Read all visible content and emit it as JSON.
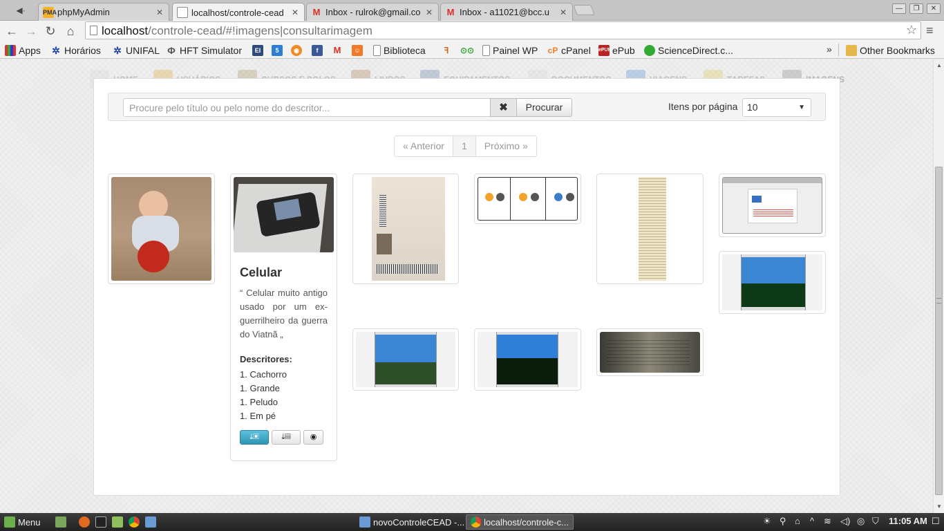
{
  "tabs": [
    {
      "title": "phpMyAdmin",
      "favicon": "pma-icon",
      "active": false
    },
    {
      "title": "localhost/controle-cead",
      "favicon": "page-icon",
      "active": true
    },
    {
      "title": "Inbox - rulrok@gmail.co",
      "favicon": "gmail-icon",
      "active": false
    },
    {
      "title": "Inbox - a11021@bcc.u",
      "favicon": "gmail-icon",
      "active": false
    }
  ],
  "address_bar": {
    "host": "localhost",
    "path": "/controle-cead/#!imagens|consultarimagem"
  },
  "bookmarks": [
    {
      "label": "Apps",
      "icon": "apps-grid-icon"
    },
    {
      "label": "Horários",
      "icon": "unifal-icon"
    },
    {
      "label": "UNIFAL",
      "icon": "unifal-icon"
    },
    {
      "label": "HFT Simulator",
      "icon": "hft-icon"
    },
    {
      "label": "",
      "icon": "blue-square-icon"
    },
    {
      "label": "",
      "icon": "five-icon"
    },
    {
      "label": "",
      "icon": "orange-circle-icon"
    },
    {
      "label": "",
      "icon": "facebook-icon"
    },
    {
      "label": "",
      "icon": "gmail-icon"
    },
    {
      "label": "",
      "icon": "orange-square-icon"
    },
    {
      "label": "Biblioteca",
      "icon": "page-icon"
    },
    {
      "label": "",
      "icon": "feather-icon"
    },
    {
      "label": "",
      "icon": "owl-icon"
    },
    {
      "label": "Painel WP",
      "icon": "page-icon"
    },
    {
      "label": "cPanel",
      "icon": "cpanel-icon"
    },
    {
      "label": "ePub",
      "icon": "epub-icon"
    },
    {
      "label": "ScienceDirect.c...",
      "icon": "green-circle-icon"
    }
  ],
  "bookmarks_more": "»",
  "other_bookmarks": "Other Bookmarks",
  "bg_nav": [
    "HOME",
    "USUÁRIOS",
    "CURSOS E POLOS",
    "LIVROS",
    "EQUIPAMENTOS",
    "DOCUMENTOS",
    "VIAGENS",
    "TAREFAS",
    "IMAGENS"
  ],
  "search": {
    "placeholder": "Procure pelo título ou pelo nome do descritor...",
    "value": "",
    "clear_label": "✖",
    "button_label": "Procurar",
    "per_page_label": "Itens por página",
    "per_page_value": "10"
  },
  "pagination": {
    "prev": "« Anterior",
    "current": "1",
    "next": "Próximo »"
  },
  "caption_item": {
    "title": "Celular",
    "description": "“ Celular muito antigo usado por um ex-guerrilheiro da guerra do Viatnã „",
    "descriptors_heading": "Descritores:",
    "descriptors": [
      "1. Cachorro",
      "1. Grande",
      "1. Peludo",
      "1. Em pé"
    ]
  },
  "taskbar": {
    "menu_label": "Menu",
    "windows": [
      "novoControleCEAD -...",
      "localhost/controle-c..."
    ],
    "clock": "11:05 AM"
  }
}
